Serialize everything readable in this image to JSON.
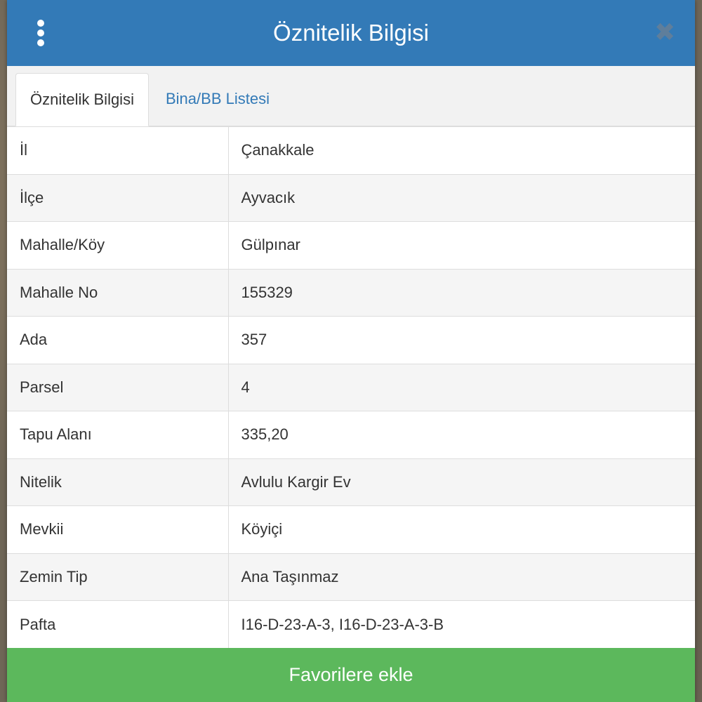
{
  "header": {
    "title": "Öznitelik Bilgisi",
    "menu_icon": "vertical-ellipsis",
    "close_icon": "close-x",
    "color": "#337ab7"
  },
  "tabs": [
    {
      "label": "Öznitelik Bilgisi",
      "active": true
    },
    {
      "label": "Bina/BB Listesi",
      "active": false
    }
  ],
  "attributes": [
    {
      "key": "İl",
      "value": "Çanakkale"
    },
    {
      "key": "İlçe",
      "value": "Ayvacık"
    },
    {
      "key": "Mahalle/Köy",
      "value": "Gülpınar"
    },
    {
      "key": "Mahalle No",
      "value": "155329"
    },
    {
      "key": "Ada",
      "value": "357"
    },
    {
      "key": "Parsel",
      "value": "4"
    },
    {
      "key": "Tapu Alanı",
      "value": "335,20"
    },
    {
      "key": "Nitelik",
      "value": "Avlulu Kargir Ev"
    },
    {
      "key": "Mevkii",
      "value": "Köyiçi"
    },
    {
      "key": "Zemin Tip",
      "value": "Ana Taşınmaz"
    },
    {
      "key": "Pafta",
      "value": "I16-D-23-A-3, I16-D-23-A-3-B"
    }
  ],
  "footer": {
    "favorite_label": "Favorilere ekle",
    "color": "#5cb85c"
  }
}
